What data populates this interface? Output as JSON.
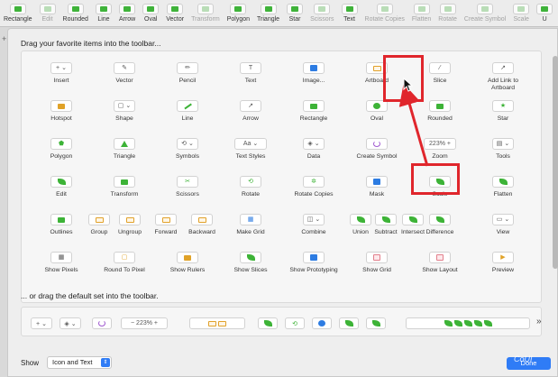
{
  "toolbar_strip": [
    {
      "label": "Rectangle",
      "dim": false
    },
    {
      "label": "Edit",
      "dim": true
    },
    {
      "label": "Rounded",
      "dim": false
    },
    {
      "label": "Line",
      "dim": false
    },
    {
      "label": "Arrow",
      "dim": false
    },
    {
      "label": "Oval",
      "dim": false
    },
    {
      "label": "Vector",
      "dim": false
    },
    {
      "label": "Transform",
      "dim": true
    },
    {
      "label": "Polygon",
      "dim": false
    },
    {
      "label": "Triangle",
      "dim": false
    },
    {
      "label": "Star",
      "dim": false
    },
    {
      "label": "Scissors",
      "dim": true
    },
    {
      "label": "Text",
      "dim": false
    },
    {
      "label": "Rotate Copies",
      "dim": true
    },
    {
      "label": "Flatten",
      "dim": true
    },
    {
      "label": "Rotate",
      "dim": true
    },
    {
      "label": "Create Symbol",
      "dim": true
    },
    {
      "label": "Scale",
      "dim": true
    },
    {
      "label": "U",
      "dim": false
    }
  ],
  "palette": {
    "title": "Drag your favorite items into the toolbar...",
    "items": [
      {
        "label": "Insert",
        "icon": "plus-dropdown-icon",
        "glyph": "+ ⌄"
      },
      {
        "label": "Vector",
        "icon": "vector-pen-icon",
        "glyph": "✎"
      },
      {
        "label": "Pencil",
        "icon": "pencil-icon",
        "glyph": "✏"
      },
      {
        "label": "Text",
        "icon": "text-icon",
        "glyph": "T"
      },
      {
        "label": "Image...",
        "icon": "image-icon",
        "glyph": ""
      },
      {
        "label": "Artboard",
        "icon": "artboard-icon",
        "glyph": ""
      },
      {
        "label": "Slice",
        "icon": "slice-icon",
        "glyph": "⁄"
      },
      {
        "label": "Add Link to\nArtboard",
        "icon": "link-artboard-icon",
        "glyph": "↗"
      },
      {
        "label": "Hotspot",
        "icon": "hotspot-icon",
        "glyph": ""
      },
      {
        "label": "Shape",
        "icon": "shape-dropdown-icon",
        "glyph": "▢ ⌄"
      },
      {
        "label": "Line",
        "icon": "line-icon",
        "glyph": ""
      },
      {
        "label": "Arrow",
        "icon": "arrow-icon",
        "glyph": "↗"
      },
      {
        "label": "Rectangle",
        "icon": "rectangle-icon",
        "glyph": ""
      },
      {
        "label": "Oval",
        "icon": "oval-icon",
        "glyph": ""
      },
      {
        "label": "Rounded",
        "icon": "rounded-icon",
        "glyph": ""
      },
      {
        "label": "Star",
        "icon": "star-icon",
        "glyph": "★"
      },
      {
        "label": "Polygon",
        "icon": "polygon-icon",
        "glyph": "⬟"
      },
      {
        "label": "Triangle",
        "icon": "triangle-icon",
        "glyph": ""
      },
      {
        "label": "Symbols",
        "icon": "symbols-icon",
        "glyph": "⟲ ⌄"
      },
      {
        "label": "Text Styles",
        "icon": "text-styles-icon",
        "glyph": "Aa ⌄"
      },
      {
        "label": "Data",
        "icon": "data-icon",
        "glyph": "◈ ⌄"
      },
      {
        "label": "Create Symbol",
        "icon": "create-symbol-icon",
        "glyph": ""
      },
      {
        "label": "Zoom",
        "icon": "zoom-icon",
        "glyph": "223%  +"
      },
      {
        "label": "Tools",
        "icon": "tools-icon",
        "glyph": "▤ ⌄"
      },
      {
        "label": "Edit",
        "icon": "edit-icon",
        "glyph": ""
      },
      {
        "label": "Transform",
        "icon": "transform-icon",
        "glyph": ""
      },
      {
        "label": "Scissors",
        "icon": "scissors-icon",
        "glyph": "✂"
      },
      {
        "label": "Rotate",
        "icon": "rotate-icon",
        "glyph": "⟲"
      },
      {
        "label": "Rotate Copies",
        "icon": "rotate-copies-icon",
        "glyph": "✲"
      },
      {
        "label": "Mask",
        "icon": "mask-icon",
        "glyph": ""
      },
      {
        "label": "Scale",
        "icon": "scale-icon",
        "glyph": ""
      },
      {
        "label": "Flatten",
        "icon": "flatten-icon",
        "glyph": ""
      },
      {
        "label": "Outlines",
        "icon": "outlines-icon",
        "glyph": ""
      },
      {
        "label": "Group",
        "icon": "group-icon",
        "glyph": ""
      },
      {
        "label": "Ungroup",
        "icon": "ungroup-icon",
        "glyph": ""
      },
      {
        "label": "Forward",
        "icon": "forward-icon",
        "glyph": ""
      },
      {
        "label": "Backward",
        "icon": "backward-icon",
        "glyph": ""
      },
      {
        "label": "Make Grid",
        "icon": "make-grid-icon",
        "glyph": "▦"
      },
      {
        "label": "Combine",
        "icon": "combine-icon",
        "glyph": "◫ ⌄"
      },
      {
        "label": "Union",
        "icon": "union-icon",
        "glyph": ""
      },
      {
        "label": "Subtract",
        "icon": "subtract-icon",
        "glyph": ""
      },
      {
        "label": "Intersect",
        "icon": "intersect-icon",
        "glyph": ""
      },
      {
        "label": "Difference",
        "icon": "difference-icon",
        "glyph": ""
      },
      {
        "label": "View",
        "icon": "view-icon",
        "glyph": "▭ ⌄"
      },
      {
        "label": "Show Pixels",
        "icon": "show-pixels-icon",
        "glyph": "▦"
      },
      {
        "label": "Round To Pixel",
        "icon": "round-to-pixel-icon",
        "glyph": "▢"
      },
      {
        "label": "Show Rulers",
        "icon": "show-rulers-icon",
        "glyph": ""
      },
      {
        "label": "Show Slices",
        "icon": "show-slices-icon",
        "glyph": ""
      },
      {
        "label": "Show Prototyping",
        "icon": "show-prototyping-icon",
        "glyph": ""
      },
      {
        "label": "Show Grid",
        "icon": "show-grid-icon",
        "glyph": ""
      },
      {
        "label": "Show Layout",
        "icon": "show-layout-icon",
        "glyph": ""
      },
      {
        "label": "Preview",
        "icon": "preview-icon",
        "glyph": "▶"
      }
    ]
  },
  "default_set": {
    "title": "... or drag the default set into the toolbar.",
    "insert_glyph": "+  ⌄",
    "data_glyph": "◈ ⌄",
    "zoom_text": "−  223%  +",
    "overflow": "»"
  },
  "footer": {
    "show_label": "Show",
    "show_value": "Icon and Text",
    "done_label": "Done",
    "watermark": "CoUI"
  },
  "annotations": {
    "highlight_color": "#e0262c"
  },
  "colors": {
    "accent_green": "#3db337",
    "accent_blue": "#2f7cf6"
  }
}
